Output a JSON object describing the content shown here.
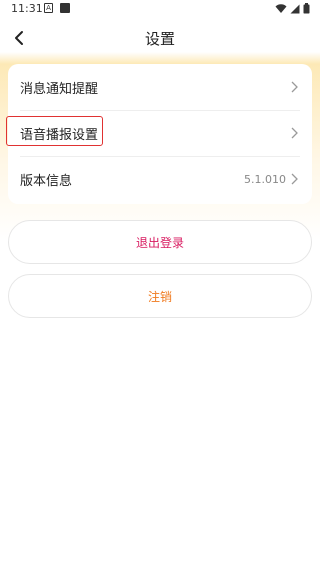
{
  "status_bar": {
    "time": "11:31",
    "a_badge": "A"
  },
  "header": {
    "title": "设置"
  },
  "settings": {
    "items": [
      {
        "label": "消息通知提醒",
        "value": ""
      },
      {
        "label": "语音播报设置",
        "value": ""
      },
      {
        "label": "版本信息",
        "value": "5.1.010"
      }
    ]
  },
  "actions": {
    "logout_label": "退出登录",
    "cancel_account_label": "注销"
  },
  "colors": {
    "highlight": "#e03232",
    "logout_text": "#d81b60",
    "cancel_account_text": "#f07a1f",
    "gradient_top": "#fde9b6"
  },
  "icons": {
    "back": "chevron-left-icon",
    "row_arrow": "chevron-right-icon",
    "wifi": "wifi-icon",
    "signal": "signal-icon",
    "battery": "battery-icon"
  }
}
